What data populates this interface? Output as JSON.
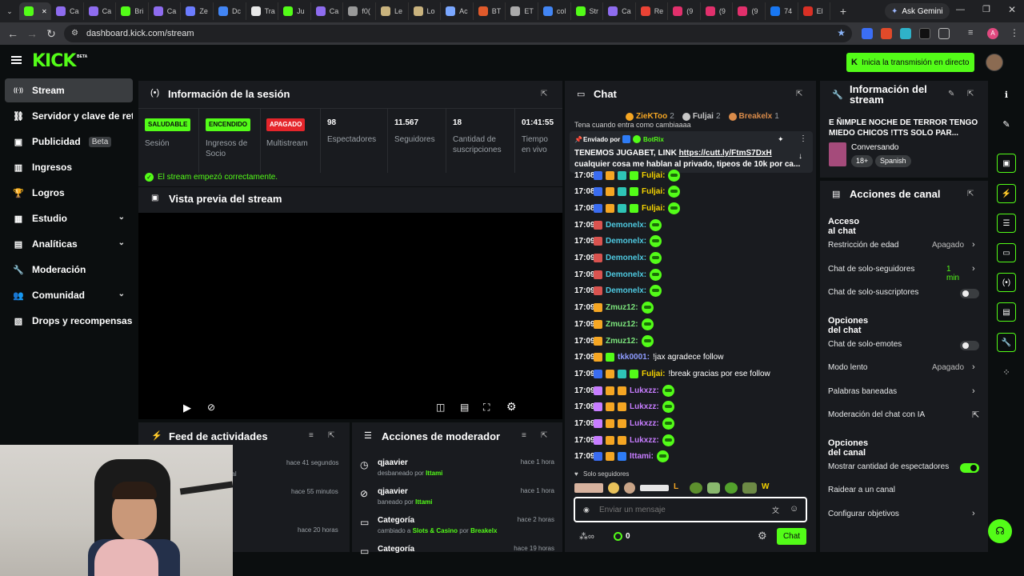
{
  "browser": {
    "tabs": [
      {
        "label": "",
        "color": "#53fc18"
      },
      {
        "label": "Ca",
        "color": "#8e6cef"
      },
      {
        "label": "Ca",
        "color": "#8e6cef"
      },
      {
        "label": "Bri",
        "color": "#53fc18"
      },
      {
        "label": "Ca",
        "color": "#8e6cef"
      },
      {
        "label": "Ze",
        "color": "#6b7cff"
      },
      {
        "label": "Dc",
        "color": "#4285f4"
      },
      {
        "label": "Tra",
        "color": "#e8e8e8"
      },
      {
        "label": "Ju",
        "color": "#53fc18"
      },
      {
        "label": "Ca",
        "color": "#8e6cef"
      },
      {
        "label": "f0(",
        "color": "#999"
      },
      {
        "label": "Le",
        "color": "#c9b37e"
      },
      {
        "label": "Lo",
        "color": "#c9b37e"
      },
      {
        "label": "Ac",
        "color": "#7aa7ff"
      },
      {
        "label": "BT",
        "color": "#e05a2b"
      },
      {
        "label": "ET",
        "color": "#aaa"
      },
      {
        "label": "col",
        "color": "#4285f4"
      },
      {
        "label": "Str",
        "color": "#53fc18"
      },
      {
        "label": "Ca",
        "color": "#8e6cef"
      },
      {
        "label": "Re",
        "color": "#ea4335"
      },
      {
        "label": "(9",
        "color": "#e1306c"
      },
      {
        "label": "(9",
        "color": "#e1306c"
      },
      {
        "label": "(9",
        "color": "#e1306c"
      },
      {
        "label": "74",
        "color": "#1877f2"
      },
      {
        "label": "El",
        "color": "#d93025"
      }
    ],
    "new_tab": "+",
    "ask_gemini": "Ask Gemini",
    "url": "dashboard.kick.com/stream",
    "profile_initial": "A"
  },
  "header": {
    "logo": "KICK",
    "logo_beta": "BETA",
    "cta": "Inicia la transmisión en directo"
  },
  "sidebar": {
    "items": [
      {
        "label": "Stream",
        "icon": "antenna-icon"
      },
      {
        "label": "Servidor y clave de retrans",
        "icon": "link-icon"
      },
      {
        "label": "Publicidad",
        "icon": "ad-icon",
        "badge": "Beta"
      },
      {
        "label": "Ingresos",
        "icon": "bar-chart-icon"
      },
      {
        "label": "Logros",
        "icon": "trophy-icon"
      },
      {
        "label": "Estudio",
        "icon": "studio-icon"
      },
      {
        "label": "Analíticas",
        "icon": "analytics-icon"
      },
      {
        "label": "Moderación",
        "icon": "wrench-icon"
      },
      {
        "label": "Comunidad",
        "icon": "community-icon"
      },
      {
        "label": "Drops y recompensas",
        "icon": "drops-icon"
      }
    ]
  },
  "session": {
    "title": "Información de la sesión",
    "stats": [
      {
        "badge": "SALUDABLE",
        "label": "Sesión",
        "color": "#53fc18"
      },
      {
        "badge": "ENCENDIDO",
        "label": "Ingresos de Socio",
        "color": "#53fc18"
      },
      {
        "badge": "APAGADO",
        "label": "Multistream",
        "color": "#e5252b"
      }
    ],
    "numbers": [
      {
        "value": "98",
        "label": "Espectadores"
      },
      {
        "value": "11.567",
        "label": "Seguidores"
      },
      {
        "value": "18",
        "label": "Cantidad de suscripciones"
      },
      {
        "value": "01:41:55",
        "label": "Tiempo en vivo"
      }
    ],
    "notice": "El stream empezó correctamente."
  },
  "preview": {
    "title": "Vista previa del stream"
  },
  "activity": {
    "title": "Feed de actividades",
    "rows": [
      {
        "time": "hace 41 segundos",
        "frag": "nal"
      },
      {
        "time": "hace 55 minutos",
        "frag": ""
      },
      {
        "time": "hace 20 horas",
        "frag": ""
      }
    ]
  },
  "modactions": {
    "title": "Acciones de moderador",
    "rows": [
      {
        "name": "qjaavier",
        "pre": "desbaneado por ",
        "by": "Ittami",
        "post": "",
        "time": "hace 1 hora",
        "icon": "clock-icon"
      },
      {
        "name": "qjaavier",
        "pre": "baneado por ",
        "by": "Ittami",
        "post": "",
        "time": "hace 1 hora",
        "icon": "ban-icon"
      },
      {
        "name": "Categoría",
        "pre": "cambiado a ",
        "by": "Slots & Casino",
        "post": " por ",
        "by2": "Breakelx",
        "time": "hace 2 horas",
        "icon": "category-icon"
      },
      {
        "name": "Categoría",
        "pre": "",
        "by": "",
        "post": "",
        "time": "hace 19 horas",
        "icon": "category-icon"
      }
    ]
  },
  "chat": {
    "title": "Chat",
    "top": [
      {
        "name": "ZieKToo",
        "count": "2",
        "color": "#f5a623"
      },
      {
        "name": "Fuljai",
        "count": "2",
        "color": "#c8c8c8"
      },
      {
        "name": "Breakelx",
        "count": "1",
        "color": "#d98b4a"
      }
    ],
    "truncated": "Tena cuando entra como cambiaaaa",
    "pinned": {
      "sent_by": "Enviado por",
      "author": "BotRix",
      "text": "TENEMOS JUGABET, LINK ",
      "link": "https://cutt.ly/FtmS7DxH",
      "text2": "cualquier cosa me hablan al privado, tipeos de 10k por ca..."
    },
    "messages": [
      {
        "time": "17:08",
        "user": "Fuljai:",
        "color": "#f5d300",
        "text": ""
      },
      {
        "time": "17:08",
        "user": "Fuljai:",
        "color": "#f5d300",
        "text": ""
      },
      {
        "time": "17:08",
        "user": "Fuljai:",
        "color": "#f5d300",
        "text": ""
      },
      {
        "time": "17:09",
        "user": "Demonelx:",
        "color": "#4ec9e0",
        "text": ""
      },
      {
        "time": "17:09",
        "user": "Demonelx:",
        "color": "#4ec9e0",
        "text": ""
      },
      {
        "time": "17:09",
        "user": "Demonelx:",
        "color": "#4ec9e0",
        "text": ""
      },
      {
        "time": "17:09",
        "user": "Demonelx:",
        "color": "#4ec9e0",
        "text": ""
      },
      {
        "time": "17:09",
        "user": "Demonelx:",
        "color": "#4ec9e0",
        "text": ""
      },
      {
        "time": "17:09",
        "user": "Zmuz12:",
        "color": "#7be37b",
        "text": ""
      },
      {
        "time": "17:09",
        "user": "Zmuz12:",
        "color": "#7be37b",
        "text": ""
      },
      {
        "time": "17:09",
        "user": "Zmuz12:",
        "color": "#7be37b",
        "text": ""
      },
      {
        "time": "17:09",
        "user": "tkk0001:",
        "color": "#8e9cff",
        "text": " !jax agradece follow"
      },
      {
        "time": "17:09",
        "user": "Fuljai:",
        "color": "#f5d300",
        "text": " !break gracias por ese follow"
      },
      {
        "time": "17:09",
        "user": "Lukxzz:",
        "color": "#c77dff",
        "text": ""
      },
      {
        "time": "17:09",
        "user": "Lukxzz:",
        "color": "#c77dff",
        "text": ""
      },
      {
        "time": "17:09",
        "user": "Lukxzz:",
        "color": "#c77dff",
        "text": ""
      },
      {
        "time": "17:09",
        "user": "Lukxzz:",
        "color": "#c77dff",
        "text": ""
      },
      {
        "time": "17:09",
        "user": "Ittami:",
        "color": "#c77dff",
        "text": ""
      }
    ],
    "mode": "Solo seguidores",
    "placeholder": "Enviar un mensaje",
    "points": "0",
    "send": "Chat"
  },
  "streaminfo": {
    "title": "Información del stream",
    "stream_title": "E ÑIMPLE NOCHE DE TERROR TENGO MIEDO CHICOS !TTS SOLO PAR...",
    "category": "Conversando",
    "tags": [
      "18+",
      "Spanish"
    ]
  },
  "channel": {
    "title": "Acciones de canal",
    "sections": [
      {
        "heading": "Acceso al chat",
        "items": [
          {
            "label": "Restricción de edad",
            "value": "Apagado",
            "control": "chevron"
          },
          {
            "label": "Chat de solo-seguidores",
            "value": "1 min",
            "control": "chevron",
            "valcolor": "#53fc18"
          },
          {
            "label": "Chat de solo-suscriptores",
            "value": "",
            "control": "toggle-off"
          }
        ]
      },
      {
        "heading": "Opciones del chat",
        "items": [
          {
            "label": "Chat de solo-emotes",
            "value": "",
            "control": "toggle-off"
          },
          {
            "label": "Modo lento",
            "value": "Apagado",
            "control": "chevron"
          },
          {
            "label": "Palabras baneadas",
            "value": "",
            "control": "chevron"
          },
          {
            "label": "Moderación del chat con IA",
            "value": "",
            "control": "external"
          }
        ]
      },
      {
        "heading": "Opciones del canal",
        "items": [
          {
            "label": "Mostrar cantidad de espectadores",
            "value": "",
            "control": "toggle-on"
          },
          {
            "label": "Raidear a un canal",
            "value": "",
            "control": "none"
          },
          {
            "label": "Configurar objetivos",
            "value": "",
            "control": "chevron"
          }
        ]
      }
    ]
  }
}
